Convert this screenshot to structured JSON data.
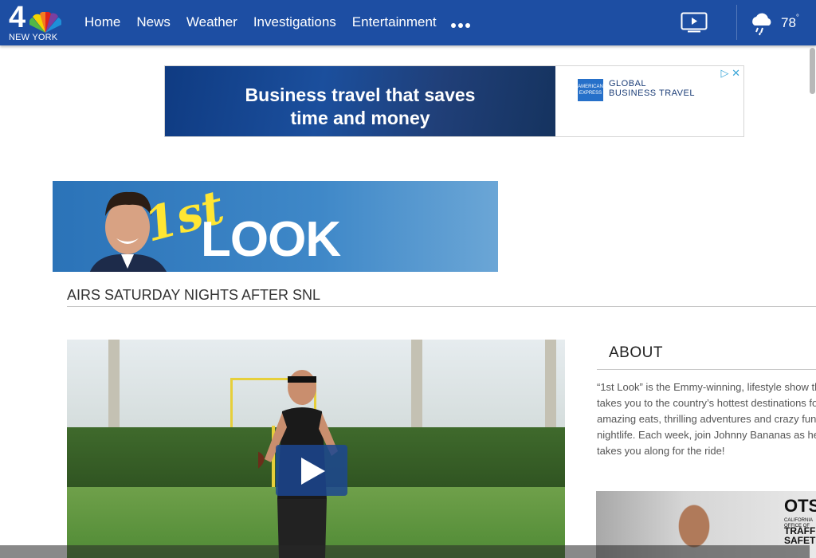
{
  "header": {
    "logo_number": "4",
    "logo_city": "NEW YORK",
    "nav": [
      "Home",
      "News",
      "Weather",
      "Investigations",
      "Entertainment"
    ],
    "more_icon": "more-dots-icon",
    "tv_icon": "tv-play-icon",
    "weather_icon": "rain-cloud-icon",
    "temperature": "78",
    "temperature_unit": "°"
  },
  "ad_top": {
    "headline_line1": "Business travel that saves",
    "headline_line2": "time and money",
    "brand_badge": "AMERICAN EXPRESS",
    "brand_line1": "GLOBAL",
    "brand_line2": "BUSINESS TRAVEL",
    "adchoices_icon": "adchoices-icon",
    "close_icon": "close-icon"
  },
  "show_banner": {
    "first": "1st",
    "look": "LOOK"
  },
  "airs_text": "AIRS SATURDAY NIGHTS AFTER SNL",
  "video": {
    "play_icon": "play-icon"
  },
  "about": {
    "title": "ABOUT",
    "lines": [
      "“1st Look” is the Emmy-winning, lifestyle show th",
      "takes you to the country’s hottest destinations fo",
      "amazing eats, thrilling adventures and crazy fun",
      "nightlife. Each week, join Johnny Bananas as he",
      "takes you along for the ride!"
    ]
  },
  "side_ad": {
    "brand": "OTS",
    "sub_line": "CALIFORNIA OFFICE OF",
    "traffic_line1": "TRAFF",
    "traffic_line2": "SAFET"
  },
  "colors": {
    "header_blue": "#1d4ea3",
    "ad_blue": "#1b4f9d",
    "banner_blue": "#3f88c8",
    "logo_yellow": "#ffe633"
  }
}
